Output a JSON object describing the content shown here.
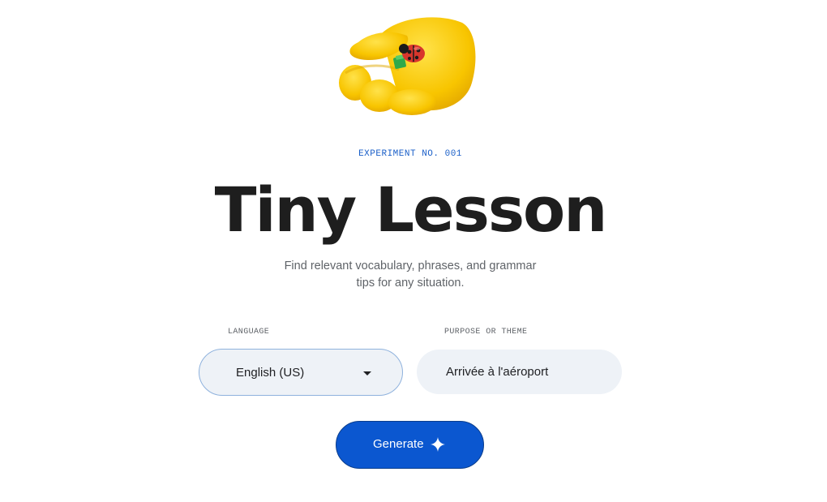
{
  "hero": {
    "illustration": "yellow-hand-holding-ladybug-icon"
  },
  "header": {
    "eyebrow": "EXPERIMENT NO. 001",
    "title": "Tiny Lesson",
    "subtitle_line1": "Find relevant vocabulary, phrases, and grammar",
    "subtitle_line2": "tips for any situation."
  },
  "form": {
    "language": {
      "label": "LANGUAGE",
      "selected": "English (US)",
      "icon": "caret-down-icon"
    },
    "purpose": {
      "label": "PURPOSE OR THEME",
      "value": "Arrivée à l'aéroport"
    },
    "generate": {
      "label": "Generate",
      "icon": "sparkle-icon"
    }
  },
  "colors": {
    "accent": "#0b57d0",
    "eyebrow": "#1a5fc8",
    "field_bg": "#eef2f7",
    "title": "#1e1e1e"
  }
}
